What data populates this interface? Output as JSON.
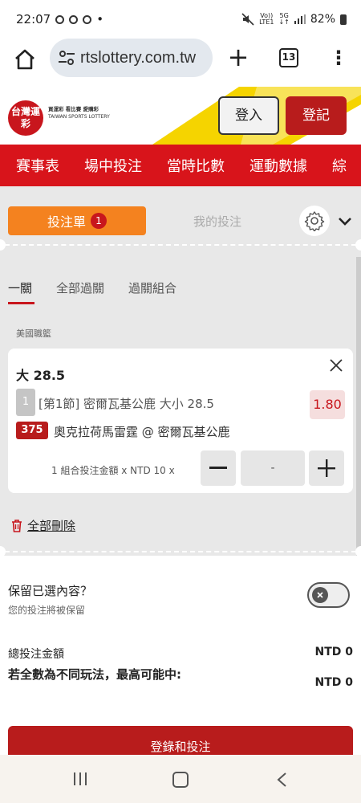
{
  "status_bar": {
    "time": "22:07",
    "dot": "•",
    "network_top": "Vo))",
    "network_bottom": "LTE1",
    "signal_top": "5G",
    "signal_bottom": "↓↑",
    "battery": "82%"
  },
  "browser": {
    "url": "rtslottery.com.tw",
    "tab_count": "13"
  },
  "site": {
    "logo_text": "台灣運彩",
    "logo_tagline": "買運彩 看比賽 愛購彩",
    "logo_en": "TAIWAN SPORTS LOTTERY",
    "login_label": "登入",
    "register_label": "登記"
  },
  "nav": {
    "items": [
      "賽事表",
      "場中投注",
      "當時比數",
      "運動數據",
      "綜"
    ]
  },
  "betslip": {
    "tab_label": "投注單",
    "badge_count": "1",
    "mybets_label": "我的投注",
    "subtabs": [
      "一關",
      "全部過關",
      "過關組合"
    ],
    "league": "美國職籃",
    "bet": {
      "title": "大 28.5",
      "order_no": "1",
      "description": "[第1節] 密爾瓦基公鹿 大小 28.5",
      "odds": "1.80",
      "match_no": "375",
      "match_name": "奧克拉荷馬雷霆 @ 密爾瓦基公鹿",
      "stake_label": "1 組合投注金額 x NTD 10 x",
      "stake_value": "-"
    },
    "delete_all": "全部刪除",
    "keep_title": "保留已選內容？",
    "keep_sub": "您的投注將被保留",
    "total_label": "總投注金額",
    "total_value": "NTD 0",
    "max_win_label": "若全數為不同玩法，最高可能中:",
    "max_win_value": "NTD 0",
    "submit_label": "登錄和投注"
  },
  "colors": {
    "brand_red": "#d8141b",
    "orange": "#f4821f",
    "yellow": "#f5d400"
  }
}
